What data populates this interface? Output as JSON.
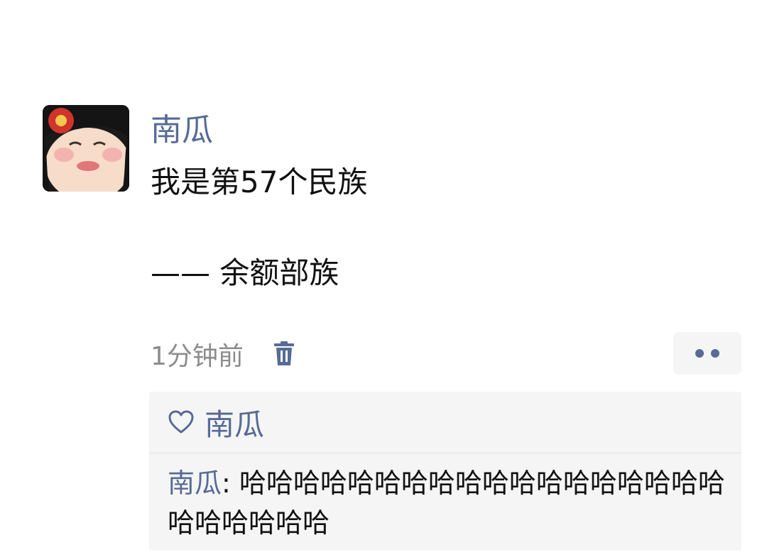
{
  "post": {
    "author": "南瓜",
    "content_line1": "我是第57个民族",
    "content_line2": "—— 余额部族",
    "time": "1分钟前",
    "icons": {
      "delete": "trash-icon",
      "more": "more-dots-icon",
      "like": "heart-icon"
    }
  },
  "interactions": {
    "likes": [
      "南瓜"
    ],
    "comments": [
      {
        "name": "南瓜",
        "separator": ": ",
        "text": "哈哈哈哈哈哈哈哈哈哈哈哈哈哈哈哈哈哈哈哈哈哈哈哈"
      }
    ]
  },
  "colors": {
    "link": "#576b95",
    "text": "#111111",
    "meta": "#8c8c8c",
    "panel": "#f5f5f5"
  }
}
